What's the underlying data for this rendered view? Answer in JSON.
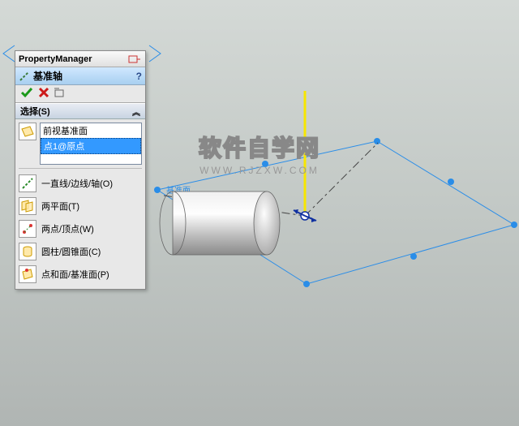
{
  "panel": {
    "title": "PropertyManager",
    "feature_name": "基准轴",
    "section_title": "选择(S)",
    "selections": [
      "前视基准面",
      "点1@原点"
    ],
    "options": [
      {
        "label": "一直线/边线/轴(O)",
        "icon": "line"
      },
      {
        "label": "两平面(T)",
        "icon": "two-planes"
      },
      {
        "label": "两点/顶点(W)",
        "icon": "two-points"
      },
      {
        "label": "圆柱/圆锥面(C)",
        "icon": "cylinder"
      },
      {
        "label": "点和面/基准面(P)",
        "icon": "point-face"
      }
    ]
  },
  "watermark": {
    "text": "软件自学网",
    "url": "WWW.RJZXW.COM"
  },
  "plane_label": "基准面"
}
